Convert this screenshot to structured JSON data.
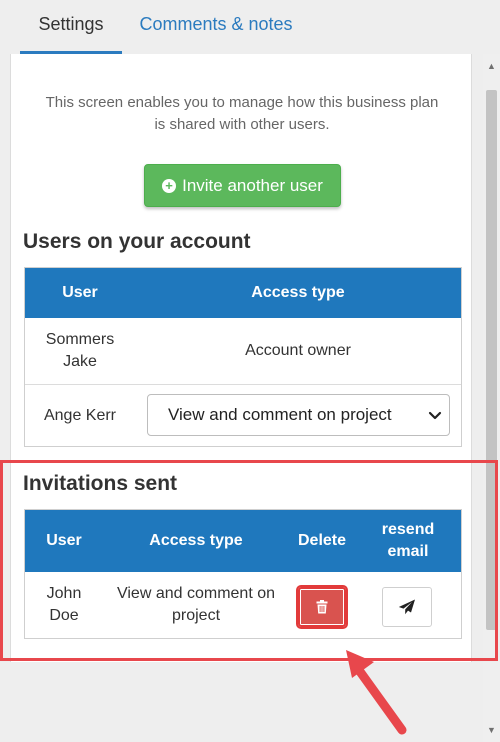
{
  "tabs": [
    {
      "label": "Settings",
      "active": true
    },
    {
      "label": "Comments & notes",
      "active": false
    }
  ],
  "intro": {
    "line1": "This screen enables you to manage how this business plan",
    "line2": "is shared with other users."
  },
  "invite_button": {
    "label": "Invite another user",
    "icon": "plus-circle-icon",
    "color": "#5cb85c"
  },
  "users_section": {
    "title": "Users on your account",
    "columns": [
      "User",
      "Access type"
    ],
    "rows": [
      {
        "user_line1": "Sommers",
        "user_line2": "Jake",
        "access": "Account owner"
      },
      {
        "user": "Ange Kerr",
        "access_selected": "View and comment on project"
      }
    ]
  },
  "invitations_section": {
    "title": "Invitations sent",
    "columns": {
      "user": "User",
      "access": "Access type",
      "delete": "Delete",
      "resend_line1": "resend",
      "resend_line2": "email"
    },
    "rows": [
      {
        "user_line1": "John",
        "user_line2": "Doe",
        "access_line1": "View and comment on",
        "access_line2": "project",
        "delete_icon": "trash-icon",
        "resend_icon": "paper-plane-icon"
      }
    ]
  },
  "colors": {
    "header_blue": "#1f78bd",
    "tab_link": "#2b7bbf",
    "delete_red": "#d9534f",
    "highlight_red": "#e8474c"
  }
}
